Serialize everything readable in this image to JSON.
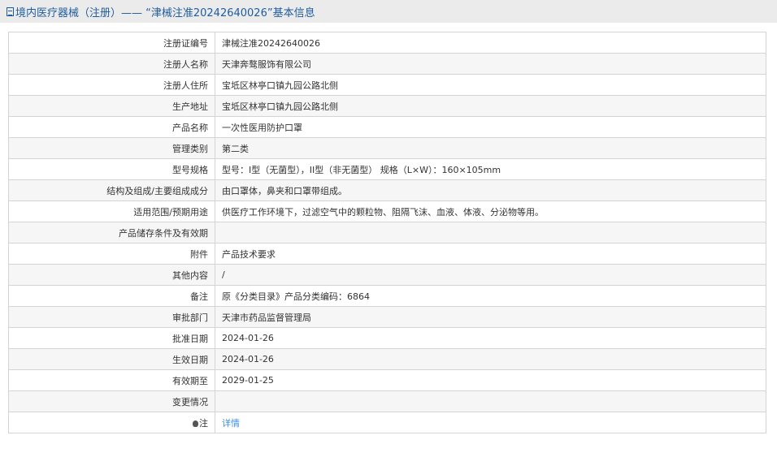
{
  "header": {
    "title": "境内医疗器械（注册）——  “津械注准20242640026”基本信息"
  },
  "rows": [
    {
      "label": "注册证编号",
      "value": "津械注准20242640026"
    },
    {
      "label": "注册人名称",
      "value": "天津奔骜服饰有限公司"
    },
    {
      "label": "注册人住所",
      "value": "宝坻区林亭口镇九园公路北侧"
    },
    {
      "label": "生产地址",
      "value": "宝坻区林亭口镇九园公路北侧"
    },
    {
      "label": "产品名称",
      "value": "一次性医用防护口罩"
    },
    {
      "label": "管理类别",
      "value": "第二类"
    },
    {
      "label": "型号规格",
      "value": "型号：I型（无菌型），II型（非无菌型） 规格（L×W）：160×105mm"
    },
    {
      "label": "结构及组成/主要组成成分",
      "value": "由口罩体，鼻夹和口罩带组成。"
    },
    {
      "label": "适用范围/预期用途",
      "value": "供医疗工作环境下，过滤空气中的颗粒物、阻隔飞沫、血液、体液、分泌物等用。"
    },
    {
      "label": "产品储存条件及有效期",
      "value": ""
    },
    {
      "label": "附件",
      "value": "产品技术要求"
    },
    {
      "label": "其他内容",
      "value": "/"
    },
    {
      "label": "备注",
      "value": "原《分类目录》产品分类编码：6864"
    },
    {
      "label": "审批部门",
      "value": "天津市药品监督管理局"
    },
    {
      "label": "批准日期",
      "value": "2024-01-26"
    },
    {
      "label": "生效日期",
      "value": "2024-01-26"
    },
    {
      "label": "有效期至",
      "value": "2029-01-25"
    },
    {
      "label": "变更情况",
      "value": ""
    }
  ],
  "note": {
    "label": "注",
    "link": "详情"
  }
}
